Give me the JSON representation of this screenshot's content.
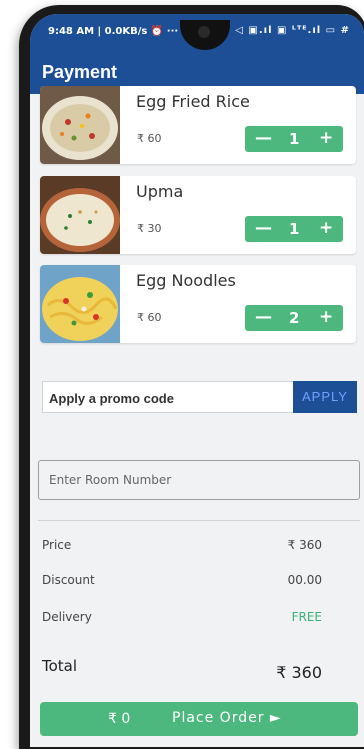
{
  "status": {
    "time": "9:48 AM | 0.0KB/s ⏰  ···",
    "icons": "◁ ▣.ıl ▣ ᴸᵀᴱ.ıl ▭ #"
  },
  "appbar": {
    "title": "Payment"
  },
  "items": [
    {
      "name": "Egg Fried Rice",
      "price": "₹ 60",
      "qty": "1",
      "minus": "—",
      "plus": "+"
    },
    {
      "name": "Upma",
      "price": "₹ 30",
      "qty": "1",
      "minus": "—",
      "plus": "+"
    },
    {
      "name": "Egg Noodles",
      "price": "₹ 60",
      "qty": "2",
      "minus": "—",
      "plus": "+"
    }
  ],
  "promo": {
    "placeholder": "Apply a promo code",
    "button": "APPLY"
  },
  "room": {
    "placeholder": "Enter Room Number"
  },
  "summary": {
    "price_label": "Price",
    "price_value": "₹ 360",
    "discount_label": "Discount",
    "discount_value": "00.00",
    "delivery_label": "Delivery",
    "delivery_value": "FREE",
    "total_label": "Total",
    "total_value": "₹ 360"
  },
  "place_order": {
    "amount": "₹ 0",
    "label": "Place Order ►"
  },
  "colors": {
    "brand": "#1d4f97",
    "accent": "#4cb87e",
    "free": "#3ab07a"
  }
}
